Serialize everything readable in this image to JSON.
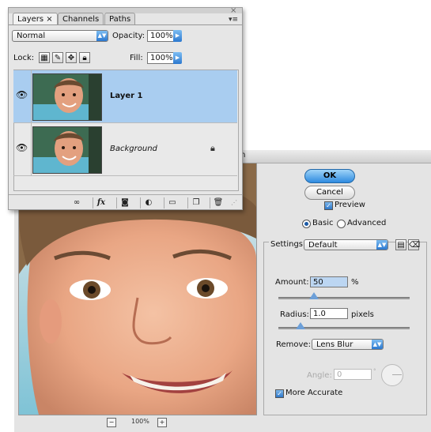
{
  "dialog": {
    "title": "en",
    "ok_label": "OK",
    "cancel_label": "Cancel",
    "preview_label": "Preview",
    "preview_checked": true,
    "mode_basic": "Basic",
    "mode_advanced": "Advanced",
    "mode_selected": "Basic",
    "settings_label": "Settings:",
    "settings_value": "Default",
    "amount_label": "Amount:",
    "amount_value": "50",
    "amount_unit": "%",
    "amount_fraction": 0.12,
    "radius_label": "Radius:",
    "radius_value": "1.0",
    "radius_unit": "pixels",
    "radius_fraction": 0.05,
    "remove_label": "Remove:",
    "remove_value": "Lens Blur",
    "angle_label": "Angle:",
    "angle_value": "0",
    "more_accurate_label": "More Accurate",
    "more_accurate_checked": true,
    "zoom_level": "100%",
    "zoom_out_symbol": "−",
    "zoom_in_symbol": "+"
  },
  "layers_panel": {
    "tabs": [
      {
        "label": "Layers",
        "close": "×"
      },
      {
        "label": "Channels"
      },
      {
        "label": "Paths"
      }
    ],
    "panel_menu_symbol": "▾≡",
    "panel_close_symbol": "×",
    "blend_mode": "Normal",
    "opacity_label": "Opacity:",
    "opacity_value": "100%",
    "lock_label": "Lock:",
    "fill_label": "Fill:",
    "fill_value": "100%",
    "layers": [
      {
        "name": "Layer 1",
        "selected": true,
        "locked": false
      },
      {
        "name": "Background",
        "selected": false,
        "locked": true
      }
    ],
    "bottom_buttons": [
      "link-icon",
      "fx-icon",
      "mask-icon",
      "adjustment-icon",
      "folder-icon",
      "new-layer-icon",
      "trash-icon"
    ],
    "fx_label": "fx"
  },
  "colors": {
    "selected_layer": "#a9cdf0",
    "aqua_blue": "#2e8be0",
    "dialog_bg": "#e4e4e4"
  }
}
